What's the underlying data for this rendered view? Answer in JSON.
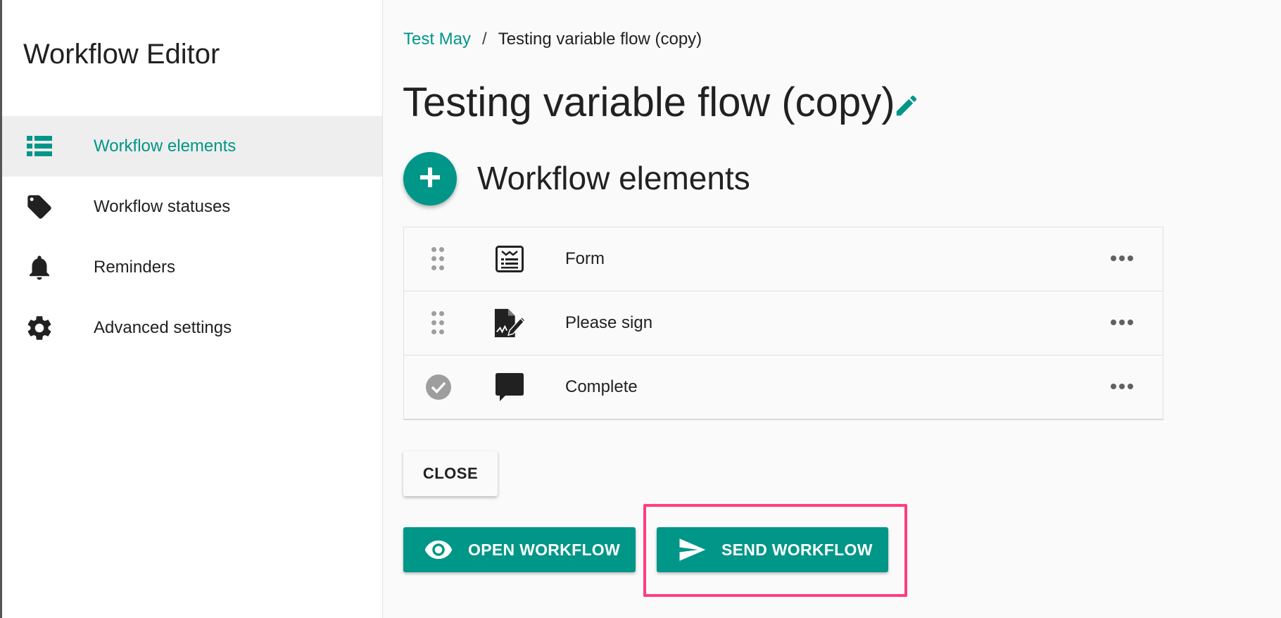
{
  "sidebar": {
    "title": "Workflow Editor",
    "items": [
      {
        "label": "Workflow elements",
        "icon": "list-icon",
        "active": true
      },
      {
        "label": "Workflow statuses",
        "icon": "tag-icon",
        "active": false
      },
      {
        "label": "Reminders",
        "icon": "bell-icon",
        "active": false
      },
      {
        "label": "Advanced settings",
        "icon": "gear-icon",
        "active": false
      }
    ]
  },
  "breadcrumb": {
    "parent": "Test May",
    "separator": "/",
    "current": "Testing variable flow (copy)"
  },
  "page": {
    "title": "Testing variable flow (copy)",
    "section_title": "Workflow elements"
  },
  "elements": [
    {
      "label": "Form",
      "icon": "form-icon",
      "state": "draggable"
    },
    {
      "label": "Please sign",
      "icon": "signature-document-icon",
      "state": "draggable"
    },
    {
      "label": "Complete",
      "icon": "comment-icon",
      "state": "completed"
    }
  ],
  "actions": {
    "close_label": "CLOSE",
    "open_label": "OPEN WORKFLOW",
    "send_label": "SEND WORKFLOW"
  },
  "colors": {
    "accent": "#009688",
    "highlight": "#ff3d7f",
    "active_bg": "#eeeeee"
  }
}
